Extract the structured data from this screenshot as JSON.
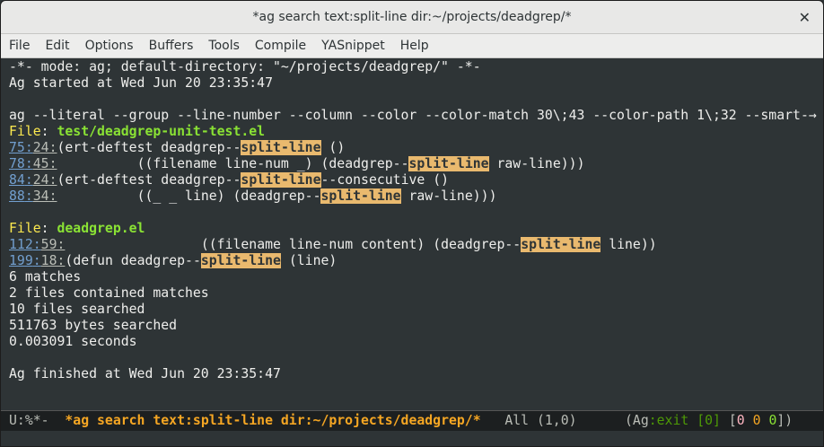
{
  "window": {
    "title": "*ag search text:split-line dir:~/projects/deadgrep/*"
  },
  "menu": [
    "File",
    "Edit",
    "Options",
    "Buffers",
    "Tools",
    "Compile",
    "YASnippet",
    "Help"
  ],
  "buffer": {
    "header": "-*- mode: ag; default-directory: \"~/projects/deadgrep/\" -*-",
    "started": "Ag started at Wed Jun 20 23:35:47",
    "command": "ag --literal --group --line-number --column --color --color-match 30\\;43 --color-path 1\\;32 --smart-",
    "wrap_arrow": "→",
    "file_label": "File",
    "groups": [
      {
        "file": "test/deadgrep-unit-test.el",
        "matches": [
          {
            "line": "75",
            "col": "24",
            "pre": "(ert-deftest deadgrep--",
            "match": "split-line",
            "post": " ()"
          },
          {
            "line": "78",
            "col": "45",
            "pre": "          ((filename line-num _) (deadgrep--",
            "match": "split-line",
            "post": " raw-line)))"
          },
          {
            "line": "84",
            "col": "24",
            "pre": "(ert-deftest deadgrep--",
            "match": "split-line",
            "post": "--consecutive ()"
          },
          {
            "line": "88",
            "col": "34",
            "pre": "          ((_ _ line) (deadgrep--",
            "match": "split-line",
            "post": " raw-line)))"
          }
        ]
      },
      {
        "file": "deadgrep.el",
        "matches": [
          {
            "line": "112",
            "col": "59",
            "pre": "                 ((filename line-num content) (deadgrep--",
            "match": "split-line",
            "post": " line))"
          },
          {
            "line": "199",
            "col": "18",
            "pre": "(defun deadgrep--",
            "match": "split-line",
            "post": " (line)"
          }
        ]
      }
    ],
    "stats": [
      "6 matches",
      "2 files contained matches",
      "10 files searched",
      "511763 bytes searched",
      "0.003091 seconds"
    ],
    "finished": "Ag finished at Wed Jun 20 23:35:47"
  },
  "modeline": {
    "state": "U:%*-",
    "buffer_name": "*ag search text:split-line dir:~/projects/deadgrep/*",
    "position": "All (1,0)",
    "mode_open": "(Ag",
    "exit": ":exit",
    "exit_code": "[0]",
    "counts_open": "[",
    "c1": "0",
    "c2": "0",
    "c3": "0",
    "counts_close": "])"
  }
}
